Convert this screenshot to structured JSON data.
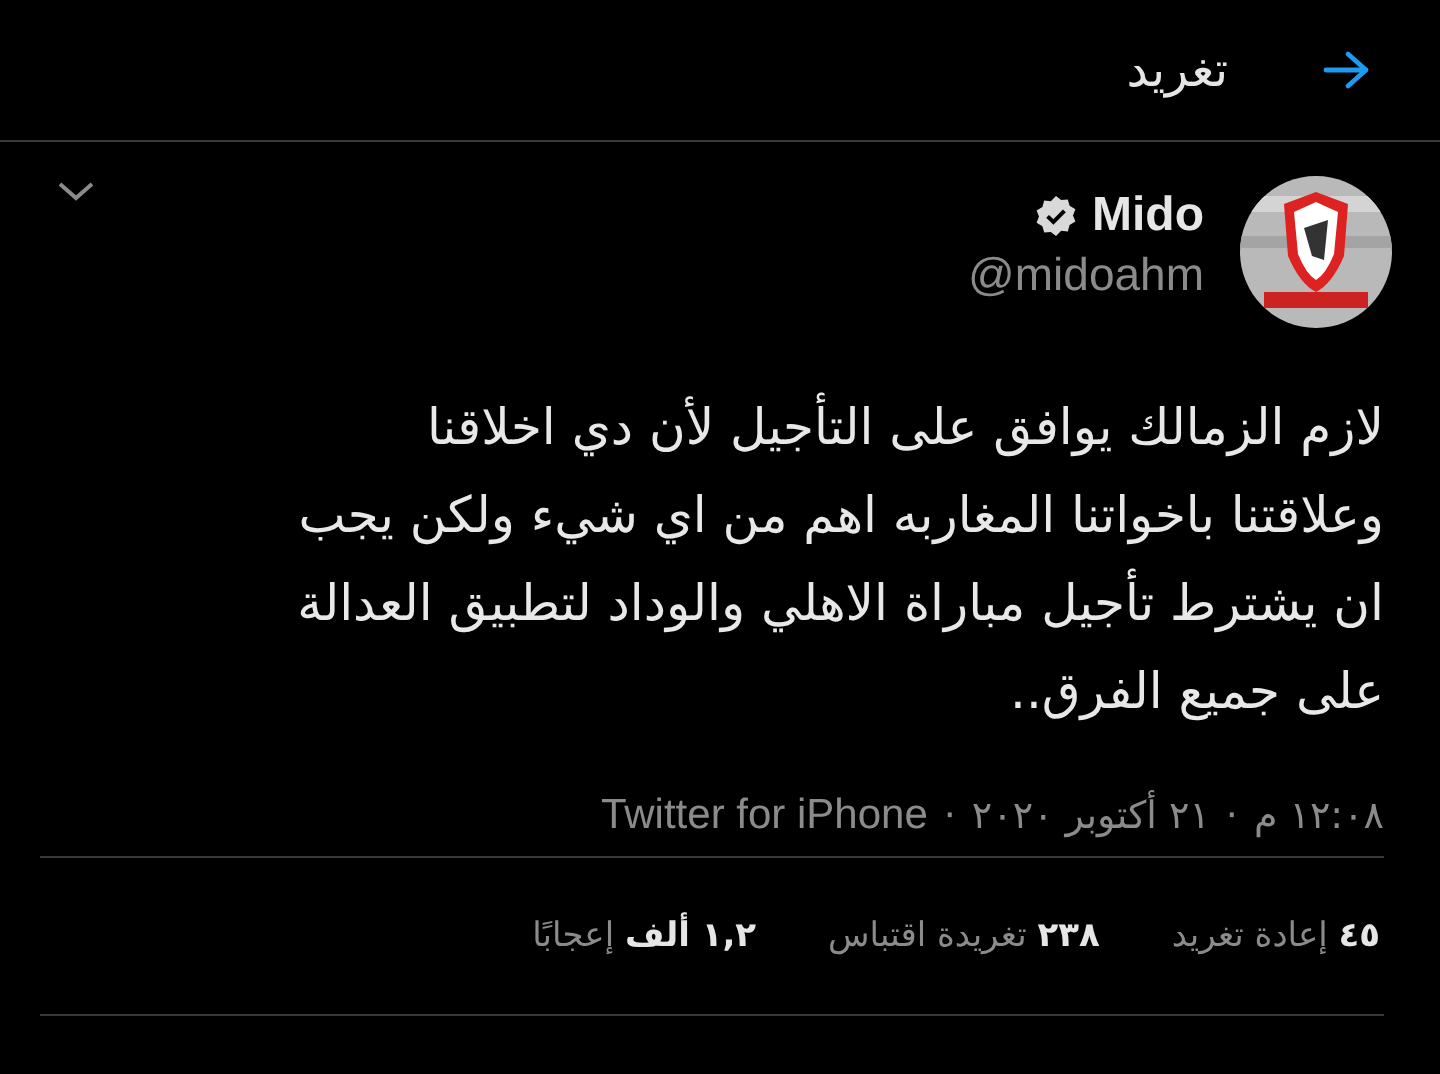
{
  "header": {
    "title": "تغريد"
  },
  "tweet": {
    "name": "Mido",
    "verified": true,
    "handle": "@midoahm",
    "text": "لازم الزمالك يوافق على التأجيل لأن دي اخلاقنا\nوعلاقتنا باخواتنا المغاربه اهم من اي شيء ولكن يجب\nان يشترط تأجيل مباراة الاهلي والوداد لتطبيق العدالة\nعلى جميع الفرق..",
    "meta": [
      "١٢:٠٨ م",
      "٢١ أكتوبر ٢٠٢٠",
      "Twitter for iPhone"
    ],
    "separator": "·",
    "stats": [
      "**٤٥** إعادة تغريد",
      "**٢٣٨** تغريدة اقتباس",
      "**١,٢ ألف** إعجابًا"
    ]
  }
}
